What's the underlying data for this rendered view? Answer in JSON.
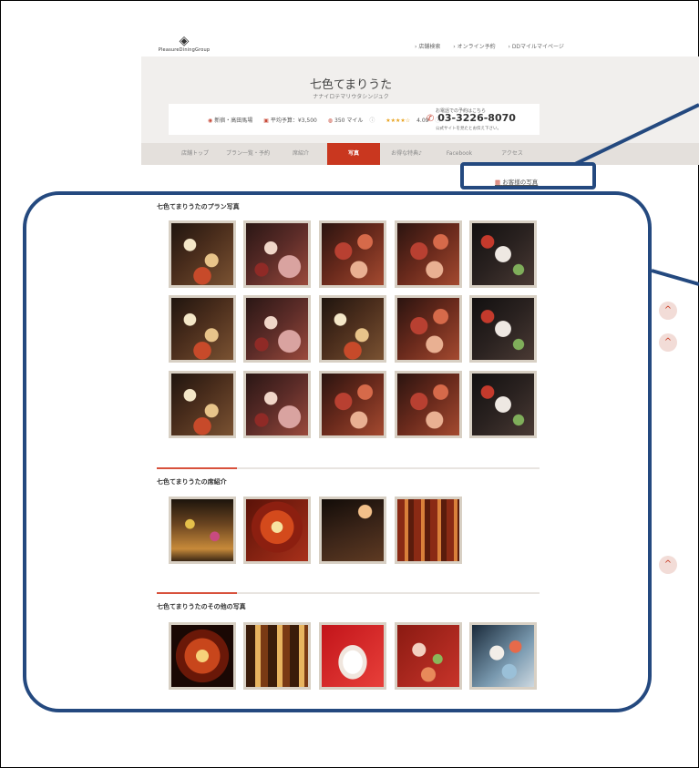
{
  "header": {
    "logo_text": "PleasureDiningGroup",
    "top_links": [
      "店舗検索",
      "オンライン予約",
      "DDマイルマイページ"
    ]
  },
  "shop": {
    "name": "七色てまりうた",
    "kana": "ナナイロテマリウタシンジュク",
    "area": "新宿・高田馬場",
    "budget": "平均予算：¥3,500",
    "miles": "350 マイル",
    "rating_stars": "★★★★☆",
    "rating": "4.09",
    "tel_note": "お電話での予約はこちら",
    "tel": "03-3226-8070",
    "tel_sub": "公式サイトを見たとお伝え下さい。"
  },
  "nav": {
    "items": [
      "店舗トップ",
      "プラン一覧・予約",
      "席紹介",
      "写真",
      "お得な特典♪",
      "Facebook",
      "アクセス"
    ],
    "active_index": 3
  },
  "guest_photos_link": "お客様の写真",
  "sections": [
    {
      "title": "七色てまりうたのプラン写真"
    },
    {
      "title": "七色てまりうたの席紹介"
    },
    {
      "title": "七色てまりうたのその他の写真"
    }
  ],
  "scroll_top_icon": "^",
  "icons": [
    "logo-diamond-icon",
    "map-pin-icon",
    "wallet-icon",
    "mile-icon",
    "star-icon",
    "phone-icon",
    "photo-icon",
    "chevron-up-icon"
  ],
  "colors": {
    "accent": "#c9371f",
    "annotation": "#24497f",
    "hero_bg": "#f1efed"
  }
}
